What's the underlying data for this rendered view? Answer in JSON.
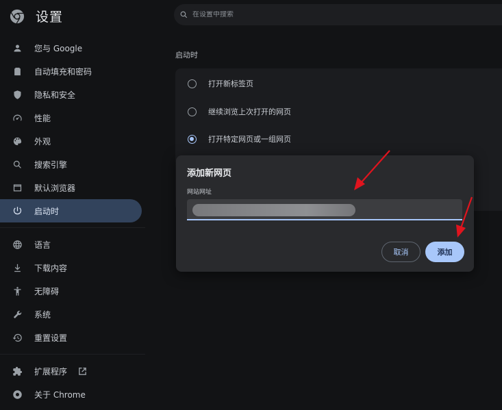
{
  "header": {
    "title": "设置"
  },
  "search": {
    "placeholder": "在设置中搜索"
  },
  "sidebar": {
    "items": [
      {
        "label": "您与 Google",
        "icon": "person-icon"
      },
      {
        "label": "自动填充和密码",
        "icon": "clipboard-icon"
      },
      {
        "label": "隐私和安全",
        "icon": "shield-icon"
      },
      {
        "label": "性能",
        "icon": "speedometer-icon"
      },
      {
        "label": "外观",
        "icon": "palette-icon"
      },
      {
        "label": "搜索引擎",
        "icon": "search-icon"
      },
      {
        "label": "默认浏览器",
        "icon": "browser-icon"
      },
      {
        "label": "启动时",
        "icon": "power-icon",
        "active": true
      }
    ],
    "items2": [
      {
        "label": "语言",
        "icon": "globe-icon"
      },
      {
        "label": "下载内容",
        "icon": "download-icon"
      },
      {
        "label": "无障碍",
        "icon": "accessibility-icon"
      },
      {
        "label": "系统",
        "icon": "wrench-icon"
      },
      {
        "label": "重置设置",
        "icon": "reset-icon"
      }
    ],
    "items3": [
      {
        "label": "扩展程序",
        "icon": "puzzle-icon"
      },
      {
        "label": "关于 Chrome",
        "icon": "chrome-icon"
      }
    ]
  },
  "startup": {
    "section_title": "启动时",
    "options": [
      {
        "label": "打开新标签页",
        "checked": false
      },
      {
        "label": "继续浏览上次打开的网页",
        "checked": false
      },
      {
        "label": "打开特定网页或一组网页",
        "checked": true
      }
    ]
  },
  "dialog": {
    "title": "添加新网页",
    "field_label": "网站网址",
    "url_value": "",
    "cancel_label": "取消",
    "add_label": "添加"
  },
  "colors": {
    "accent": "#a8c7fa",
    "active_nav": "#32435c",
    "dialog_bg": "#292a2d",
    "arrow": "#e0141e"
  }
}
